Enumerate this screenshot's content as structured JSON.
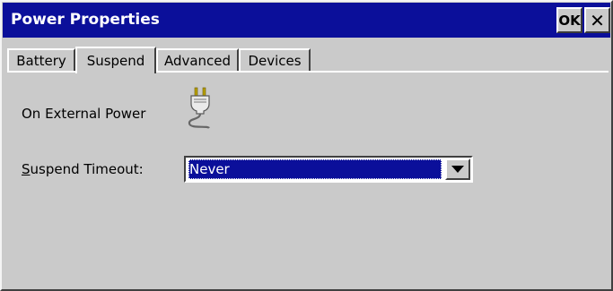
{
  "window": {
    "title": "Power Properties",
    "ok_label": "OK",
    "close_glyph": "✕"
  },
  "tabs": [
    {
      "label": "Battery",
      "active": false
    },
    {
      "label": "Suspend",
      "active": true
    },
    {
      "label": "Advanced",
      "active": false
    },
    {
      "label": "Devices",
      "active": false
    }
  ],
  "content": {
    "power_source_label": "On External Power",
    "power_icon": "power-plug-icon",
    "suspend_timeout": {
      "label_accel": "S",
      "label_rest": "uspend Timeout:",
      "selected_value": "Never"
    }
  },
  "colors": {
    "titlebar": "#0b0f9a",
    "face": "#cacaca",
    "selection": "#0b0f9a"
  }
}
